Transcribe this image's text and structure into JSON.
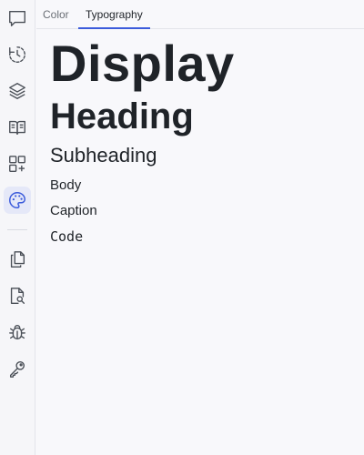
{
  "sidebar": {
    "items": [
      {
        "icon": "chat-icon"
      },
      {
        "icon": "history-icon"
      },
      {
        "icon": "layers-icon"
      },
      {
        "icon": "book-icon"
      },
      {
        "icon": "add-component-icon"
      },
      {
        "icon": "palette-icon",
        "active": true
      },
      {
        "icon": "documents-icon"
      },
      {
        "icon": "file-search-icon"
      },
      {
        "icon": "bug-icon"
      },
      {
        "icon": "key-icon"
      }
    ]
  },
  "tabs": [
    {
      "label": "Color"
    },
    {
      "label": "Typography",
      "active": true
    }
  ],
  "typography": {
    "display": "Display",
    "heading": "Heading",
    "subheading": "Subheading",
    "body": "Body",
    "caption": "Caption",
    "code": "Code"
  },
  "colors": {
    "accent": "#3b5bdb",
    "active_bg": "#e5e8f8",
    "icon": "#4a4f57",
    "active_icon": "#3b5bdb"
  }
}
